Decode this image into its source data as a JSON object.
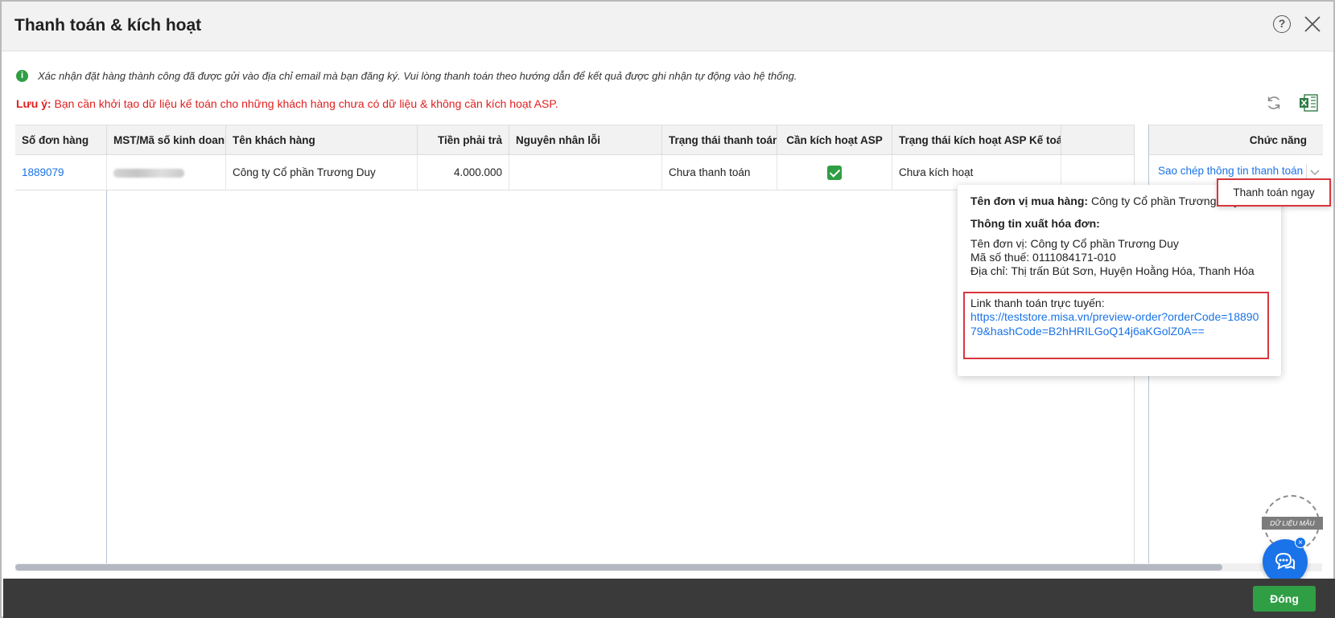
{
  "dialog": {
    "title": "Thanh toán & kích hoạt",
    "help_symbol": "?",
    "info_message": "Xác nhận đặt hàng thành công đã được gửi vào địa chỉ email mà bạn đăng ký. Vui lòng thanh toán theo hướng dẫn để kết quả được ghi nhận tự động vào hệ thống.",
    "note_label": "Lưu ý:",
    "note_text": " Bạn cần khởi tạo dữ liệu kế toán cho những khách hàng chưa có dữ liệu & không cần kích hoạt ASP."
  },
  "table": {
    "columns": [
      "Số đơn hàng",
      "MST/Mã số kinh doanh",
      "Tên khách hàng",
      "Tiền phải trả",
      "Nguyên nhân lỗi",
      "Trạng thái thanh toán",
      "Cần kích hoạt ASP",
      "Trạng thái kích hoạt ASP Kế toán",
      "Chức năng"
    ],
    "rows": [
      {
        "order_no": "1889079",
        "customer": "Công ty Cổ phần Trương Duy",
        "amount": "4.000.000",
        "error": "",
        "payment_status": "Chưa thanh toán",
        "asp_required": true,
        "asp_status": "Chưa kích hoạt",
        "action": "Sao chép thông tin thanh toán"
      }
    ]
  },
  "dropdown": {
    "pay_now": "Thanh toán ngay"
  },
  "popup": {
    "buyer_label": "Tên đơn vị mua hàng:",
    "buyer_value": " Công ty Cổ phần Trương Duy",
    "invoice_heading": "Thông tin xuất hóa đơn:",
    "unit_line": "Tên đơn vị: Công ty Cổ phần Trương Duy",
    "tax_line": "Mã số thuế: 0111084171-010",
    "address_line": "Địa chỉ: Thị trấn Bút Sơn, Huyện Hoằng Hóa, Thanh Hóa",
    "link_label": "Link thanh toán trực tuyến:",
    "link_url": "https://teststore.misa.vn/preview-order?orderCode=1889079&hashCode=B2hHRILGoQ14j6aKGolZ0A=="
  },
  "footer": {
    "close_label": "Đóng"
  },
  "stamp": {
    "text": "DỮ LIỆU MẪU"
  },
  "colors": {
    "accent_green": "#2f9e44",
    "link_blue": "#1a73e8",
    "warning_red": "#e02020",
    "highlight_red": "#d9363e"
  }
}
